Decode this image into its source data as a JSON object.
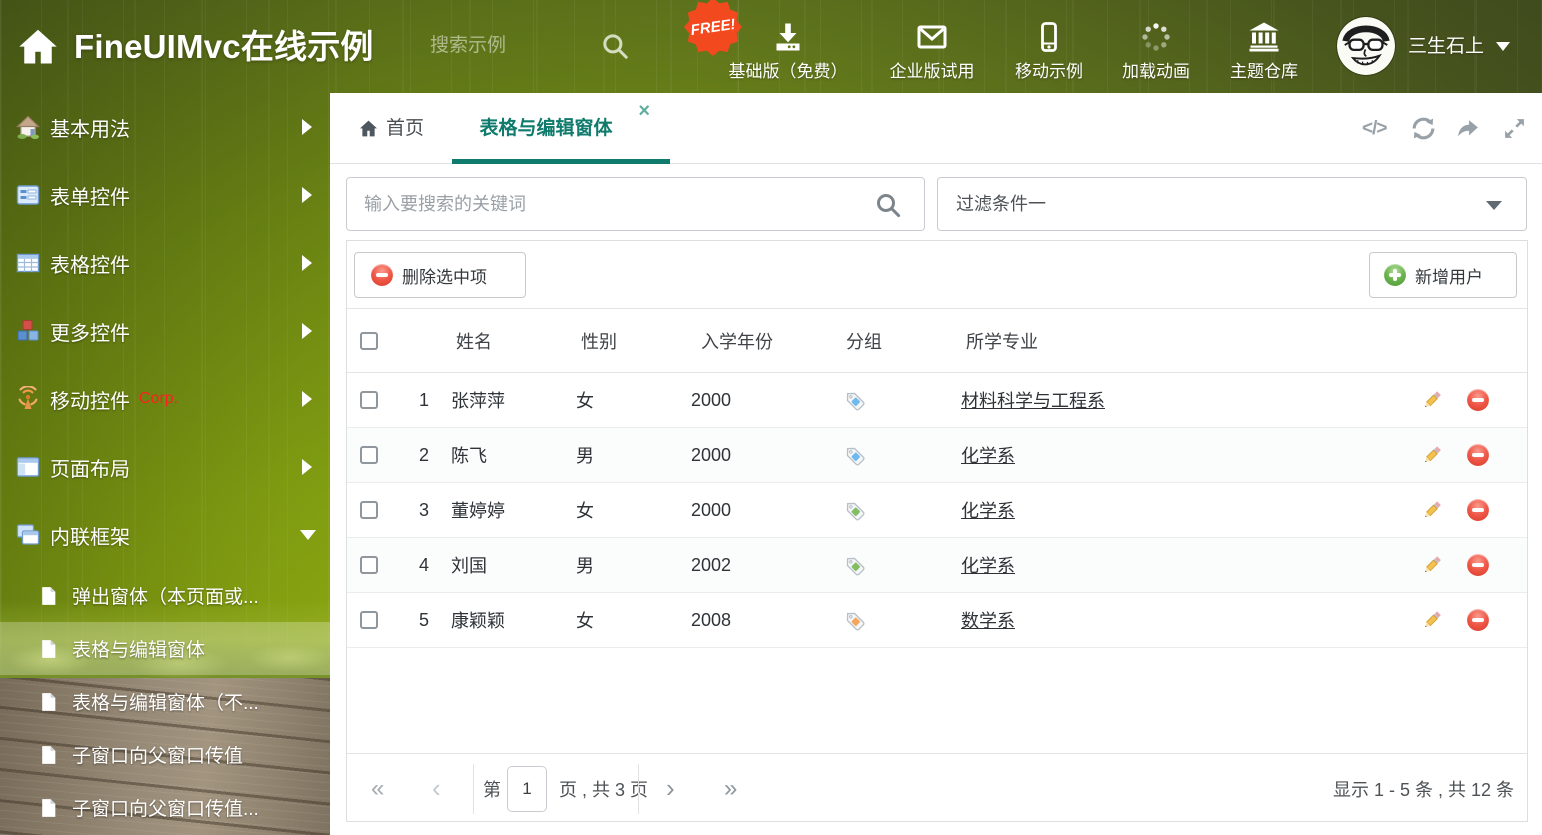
{
  "theme": {
    "accent": "#0f7b6c",
    "corp_badge": "#ff1f1f"
  },
  "header": {
    "app_title": "FineUIMvc在线示例",
    "search_placeholder": "搜索示例",
    "free_badge": "FREE!",
    "nav": [
      {
        "label": "基础版（免费）",
        "icon": "download-icon"
      },
      {
        "label": "企业版试用",
        "icon": "envelope-icon"
      },
      {
        "label": "移动示例",
        "icon": "mobile-icon"
      },
      {
        "label": "加载动画",
        "icon": "spinner-icon"
      },
      {
        "label": "主题仓库",
        "icon": "bank-icon"
      }
    ],
    "user_name": "三生石上"
  },
  "sidebar": {
    "items": [
      {
        "label": "基本用法",
        "icon": "home-icon"
      },
      {
        "label": "表单控件",
        "icon": "form-icon"
      },
      {
        "label": "表格控件",
        "icon": "table-icon"
      },
      {
        "label": "更多控件",
        "icon": "cubes-icon"
      },
      {
        "label": "移动控件",
        "badge": "Corp.",
        "icon": "antenna-icon"
      },
      {
        "label": "页面布局",
        "icon": "layout-icon"
      },
      {
        "label": "内联框架",
        "icon": "frames-icon",
        "expanded": true
      }
    ],
    "subitems": [
      {
        "label": "弹出窗体（本页面或..."
      },
      {
        "label": "表格与编辑窗体",
        "active": true
      },
      {
        "label": "表格与编辑窗体（不..."
      },
      {
        "label": "子窗口向父窗口传值"
      },
      {
        "label": "子窗口向父窗口传值..."
      }
    ]
  },
  "tabs": {
    "home_label": "首页",
    "active_label": "表格与编辑窗体"
  },
  "search": {
    "placeholder": "输入要搜索的关键词"
  },
  "filter": {
    "value": "过滤条件一"
  },
  "toolbar": {
    "delete_label": "删除选中项",
    "add_label": "新增用户"
  },
  "table": {
    "columns": {
      "name": "姓名",
      "gender": "性别",
      "year": "入学年份",
      "group": "分组",
      "major": "所学专业"
    },
    "tag_colors": {
      "blue": "#6fb9ef",
      "green": "#82bd62",
      "orange": "#f4a75c"
    },
    "rows": [
      {
        "num": "1",
        "name": "张萍萍",
        "gender": "女",
        "year": "2000",
        "tag_color": "blue",
        "major": "材料科学与工程系"
      },
      {
        "num": "2",
        "name": "陈飞",
        "gender": "男",
        "year": "2000",
        "tag_color": "blue",
        "major": "化学系"
      },
      {
        "num": "3",
        "name": "董婷婷",
        "gender": "女",
        "year": "2000",
        "tag_color": "green",
        "major": "化学系"
      },
      {
        "num": "4",
        "name": "刘国",
        "gender": "男",
        "year": "2002",
        "tag_color": "green",
        "major": "化学系"
      },
      {
        "num": "5",
        "name": "康颖颖",
        "gender": "女",
        "year": "2008",
        "tag_color": "orange",
        "major": "数学系"
      }
    ]
  },
  "pagination": {
    "prefix": "第",
    "current": "1",
    "suffix": "页 , 共 3 页",
    "summary": "显示 1 - 5 条 , 共 12 条"
  }
}
